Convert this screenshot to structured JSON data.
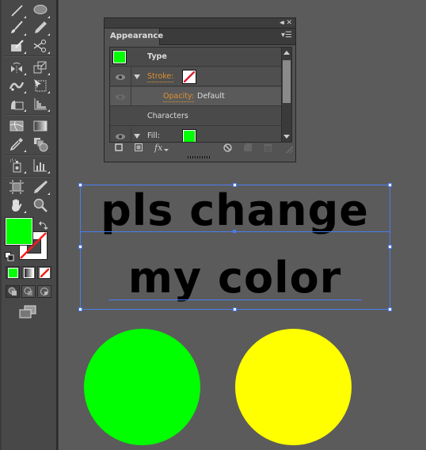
{
  "toolbar": {
    "tools": [
      {
        "name": "line-segment-tool"
      },
      {
        "name": "ellipse-tool"
      },
      {
        "name": "paintbrush-tool"
      },
      {
        "name": "pencil-tool"
      },
      {
        "name": "blob-brush-tool"
      },
      {
        "name": "scissors-tool"
      },
      {
        "name": "rotate-tool"
      },
      {
        "name": "scale-tool"
      },
      {
        "name": "width-tool"
      },
      {
        "name": "free-transform-tool"
      },
      {
        "name": "shape-builder-tool"
      },
      {
        "name": "graph-tool"
      },
      {
        "name": "mesh-tool"
      },
      {
        "name": "gradient-tool"
      },
      {
        "name": "eyedropper-tool"
      },
      {
        "name": "blend-tool"
      },
      {
        "name": "symbol-sprayer-tool"
      },
      {
        "name": "column-graph-tool"
      },
      {
        "name": "artboard-tool"
      },
      {
        "name": "slice-tool"
      },
      {
        "name": "hand-tool"
      },
      {
        "name": "zoom-tool"
      }
    ],
    "fill_color": "#00ff00",
    "stroke": "none"
  },
  "appearance_panel": {
    "tab_label": "Appearance",
    "collapse_icon": "◂◂",
    "close_icon": "✕",
    "rows": [
      {
        "label": "Type"
      },
      {
        "label": "Stroke:"
      },
      {
        "label": "Opacity:",
        "value": "Default"
      },
      {
        "label": "Characters"
      },
      {
        "label": "Fill:"
      }
    ],
    "footer_fx": "fx"
  },
  "canvas": {
    "text_line1": "pls change",
    "text_line2": "my color",
    "circles": [
      {
        "name": "green-circle",
        "color": "#00ff00"
      },
      {
        "name": "yellow-circle",
        "color": "#ffff00"
      }
    ]
  }
}
